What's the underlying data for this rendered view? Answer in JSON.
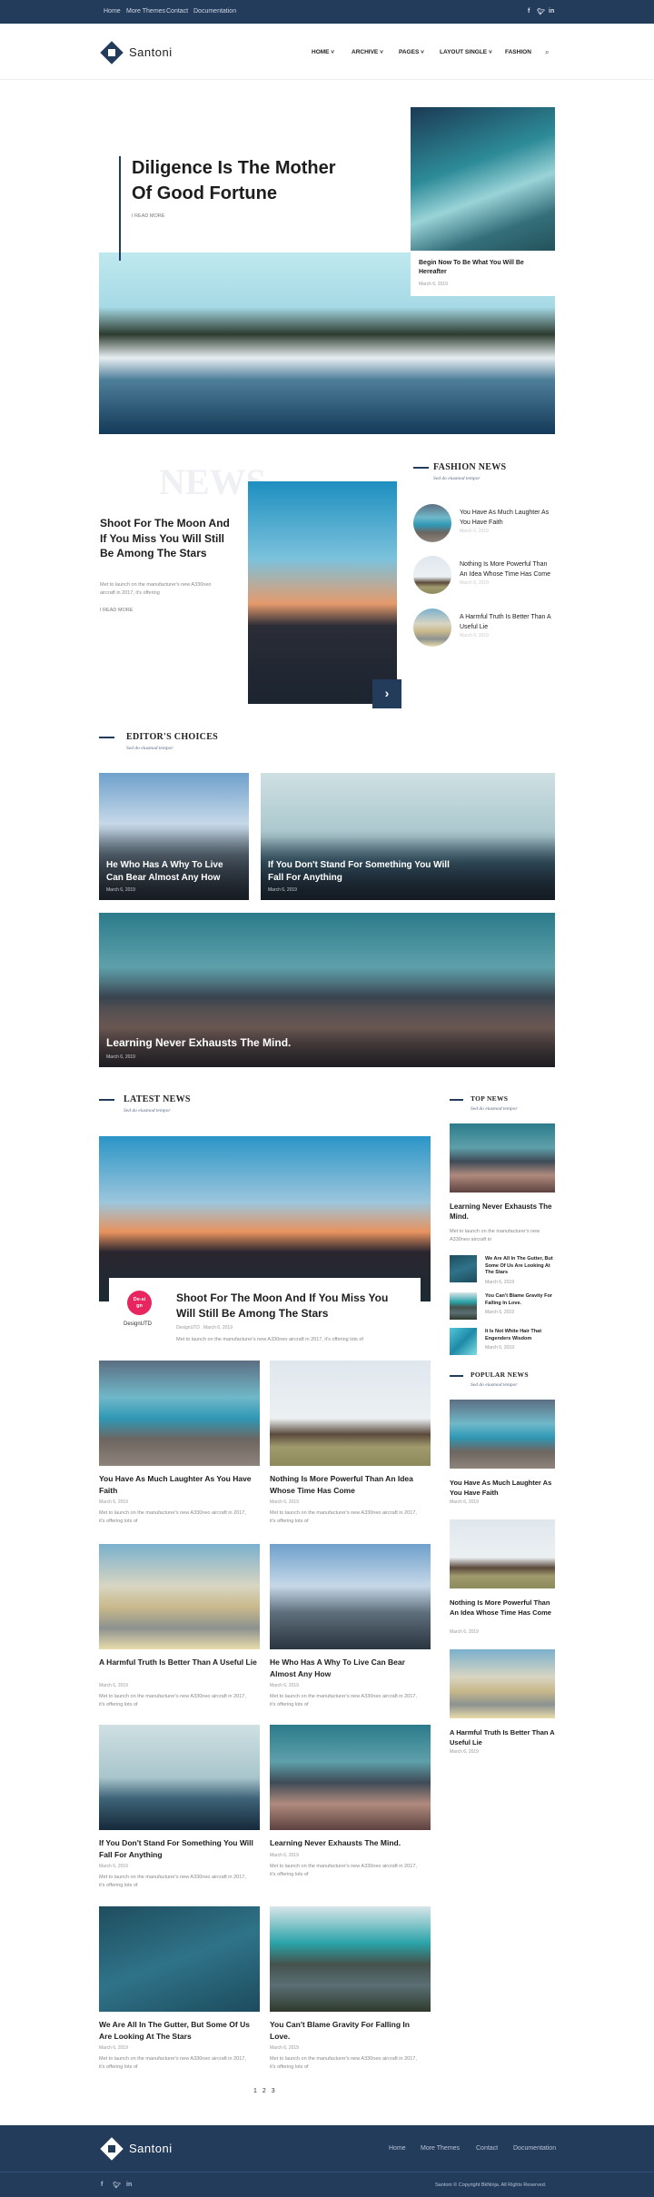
{
  "topbar": {
    "links": [
      "Home",
      "More Themes",
      "Contact",
      "Documentation"
    ],
    "social": [
      "f",
      "t",
      "in"
    ]
  },
  "header": {
    "brand": "Santoni",
    "nav": [
      "HOME",
      "ARCHIVE",
      "PAGES",
      "LAYOUT SINGLE",
      "FASHION"
    ],
    "chevron": "⌄",
    "search_icon": "search-icon"
  },
  "hero": {
    "title": "Diligence Is The Mother Of Good Fortune",
    "read_more": "I READ MORE",
    "side_title": "Begin Now To Be What You Will Be Hereafter",
    "side_date": "March 6, 2019"
  },
  "feature": {
    "watermark": "NEWS",
    "title": "Shoot For The Moon And If You Miss You Will Still Be Among The Stars",
    "excerpt": "Met to launch on the manufacturer's new A330neo aircraft in 2017, it's offering",
    "read_more": "I READ MORE",
    "next": "›"
  },
  "fashion": {
    "title": "FASHION NEWS",
    "subtitle": "Sed do eiusmod tempor",
    "items": [
      {
        "title": "You Have As Much Laughter As You Have Faith",
        "date": "March 6, 2019"
      },
      {
        "title": "Nothing Is More Powerful Than An Idea Whose Time Has Come",
        "date": "March 6, 2019"
      },
      {
        "title": "A Harmful Truth Is Better Than A Useful Lie",
        "date": "March 6, 2019"
      }
    ]
  },
  "editors": {
    "title": "EDITOR'S CHOICES",
    "subtitle": "Sed do eiusmod tempor",
    "cards": [
      {
        "title": "He Who Has A Why To Live Can Bear Almost Any How",
        "date": "March 6, 2019"
      },
      {
        "title": "If You Don't Stand For Something You Will Fall For Anything",
        "date": "March 6, 2019"
      },
      {
        "title": "Learning Never Exhausts The Mind.",
        "date": "March 6, 2019"
      }
    ]
  },
  "latest": {
    "title": "LATEST NEWS",
    "subtitle": "Sed do eiusmod tempor",
    "main": {
      "avatar": "De-sign",
      "author": "DesignUTD",
      "title": "Shoot For The Moon And If You Miss You Will Still Be Among The Stars",
      "meta": "DesignUTD . March 6, 2019",
      "excerpt": "Met to launch on the manufacturer's new A330neo aircraft in 2017, it's offering lots of"
    },
    "posts": [
      {
        "title": "You Have As Much Laughter As You Have Faith",
        "date": "March 6, 2019",
        "excerpt": "Met to launch on the manufacturer's new A330neo aircraft in 2017, it's offering lots of"
      },
      {
        "title": "Nothing Is More Powerful Than An Idea Whose Time Has Come",
        "date": "March 6, 2019",
        "excerpt": "Met to launch on the manufacturer's new A330neo aircraft in 2017, it's offering lots of"
      },
      {
        "title": "A Harmful Truth Is Better Than A Useful Lie",
        "date": "March 6, 2019",
        "excerpt": "Met to launch on the manufacturer's new A330neo aircraft in 2017, it's offering lots of"
      },
      {
        "title": "He Who Has A Why To Live Can Bear Almost Any How",
        "date": "March 6, 2019",
        "excerpt": "Met to launch on the manufacturer's new A330neo aircraft in 2017, it's offering lots of"
      },
      {
        "title": "If You Don't Stand For Something You Will Fall For Anything",
        "date": "March 6, 2019",
        "excerpt": "Met to launch on the manufacturer's new A330neo aircraft in 2017, it's offering lots of"
      },
      {
        "title": "Learning Never Exhausts The Mind.",
        "date": "March 6, 2019",
        "excerpt": "Met to launch on the manufacturer's new A330neo aircraft in 2017, it's offering lots of"
      },
      {
        "title": "We Are All In The Gutter, But Some Of Us Are Looking At The Stars",
        "date": "March 6, 2019",
        "excerpt": "Met to launch on the manufacturer's new A330neo aircraft in 2017, it's offering lots of"
      },
      {
        "title": "You Can't Blame Gravity For Falling In Love.",
        "date": "March 6, 2019",
        "excerpt": "Met to launch on the manufacturer's new A330neo aircraft in 2017, it's offering lots of"
      }
    ],
    "pagination": [
      "1",
      "2",
      "3"
    ]
  },
  "top_news": {
    "title": "TOP NEWS",
    "subtitle": "Sed do eiusmod tempor",
    "main_title": "Learning Never Exhausts The Mind.",
    "main_excerpt": "Met to launch on the manufacturer's new A330neo aircraft in",
    "items": [
      {
        "title": "We Are All In The Gutter, But Some Of Us Are Looking At The Stars",
        "date": "March 6, 2019"
      },
      {
        "title": "You Can't Blame Gravity For Falling In Love.",
        "date": "March 6, 2019"
      },
      {
        "title": "It Is Not White Hair That Engenders Wisdom",
        "date": "March 6, 2019"
      }
    ]
  },
  "popular": {
    "title": "POPULAR NEWS",
    "subtitle": "Sed do eiusmod tempor",
    "items": [
      {
        "title": "You Have As Much Laughter As You Have Faith",
        "date": "March 6, 2019"
      },
      {
        "title": "Nothing Is More Powerful Than An Idea Whose Time Has Come",
        "date": "March 6, 2019"
      },
      {
        "title": "A Harmful Truth Is Better Than A Useful Lie",
        "date": "March 6, 2019"
      }
    ]
  },
  "footer": {
    "brand": "Santoni",
    "links": [
      "Home",
      "More Themes",
      "Contact",
      "Documentation"
    ],
    "social": [
      "f",
      "t",
      "in"
    ],
    "copyright": "Santoni © Copyright BkNinja. All Rights Reserved."
  },
  "colors": {
    "navy": "#243c5c",
    "accent": "#e8255f"
  }
}
